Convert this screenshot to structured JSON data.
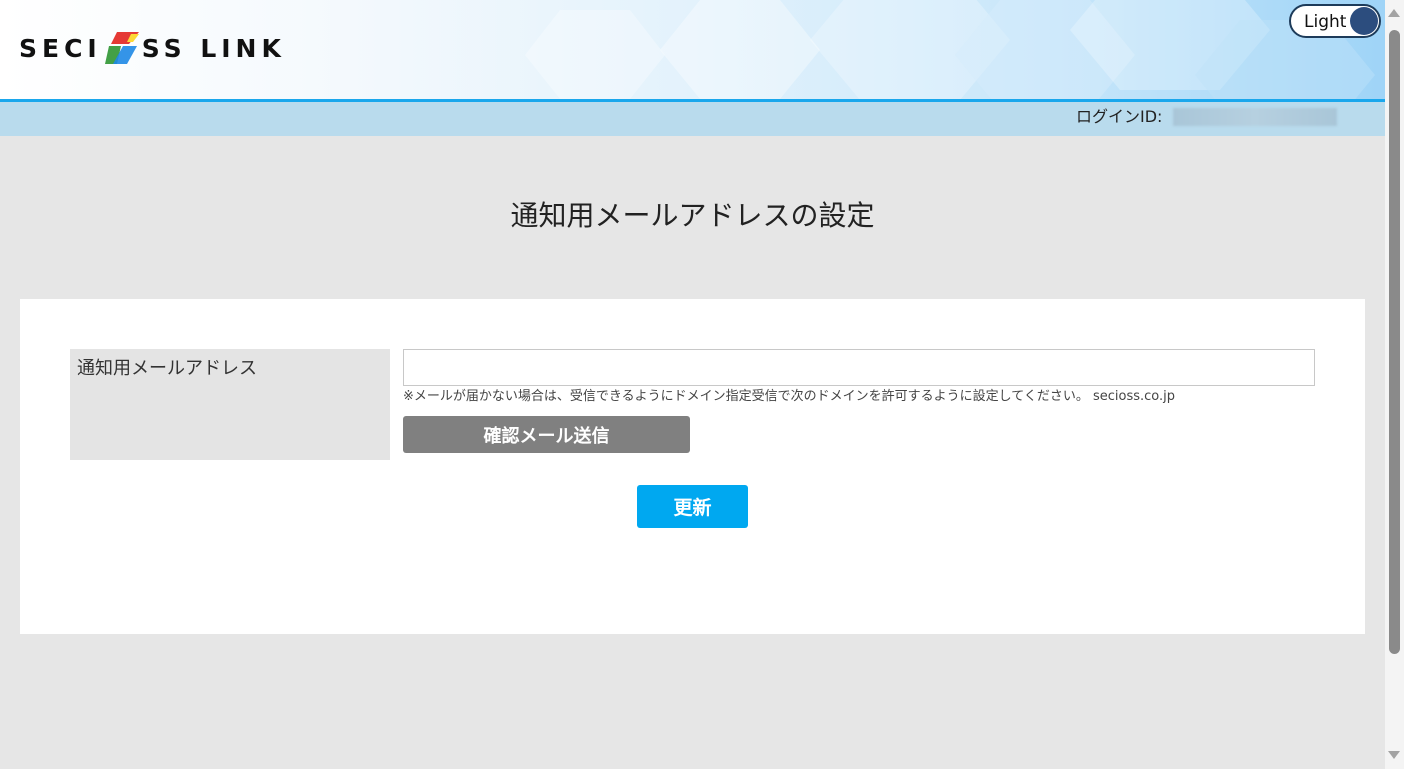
{
  "header": {
    "logo_text_1": "SECI",
    "logo_text_2": "SS LINK",
    "theme_toggle_label": "Light",
    "login_id_label": "ログインID:",
    "login_id_value": ""
  },
  "page": {
    "title": "通知用メールアドレスの設定"
  },
  "form": {
    "email_label": "通知用メールアドレス",
    "email_value": "",
    "email_placeholder": "",
    "hint": "※メールが届かない場合は、受信できるようにドメイン指定受信で次のドメインを許可するように設定してください。 secioss.co.jp",
    "confirm_button_label": "確認メール送信",
    "update_button_label": "更新"
  },
  "colors": {
    "accent_blue": "#00a8f0",
    "header_line": "#1aa7ec",
    "subbar": "#b9dbed",
    "confirm_button": "#808080",
    "toggle_knob": "#2c4d7e"
  }
}
